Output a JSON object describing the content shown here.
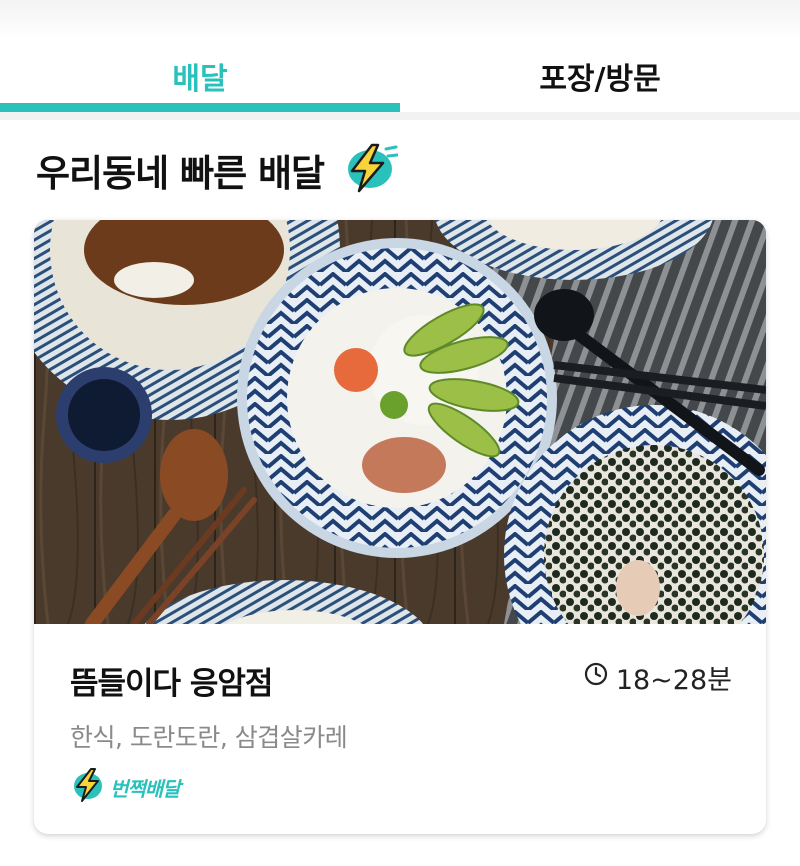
{
  "tabs": [
    {
      "label": "배달",
      "active": true
    },
    {
      "label": "포장/방문",
      "active": false
    }
  ],
  "section": {
    "title": "우리동네 빠른 배달",
    "icon": "lightning-bolt-icon"
  },
  "store": {
    "name": "뜸들이다 응암점",
    "delivery_time": "18~28분",
    "categories": "한식, 도란도란, 삼겹살카레",
    "badge": "번쩍배달",
    "photo": "food-photo"
  },
  "colors": {
    "accent": "#2ac1bc",
    "badge_yellow": "#f6d43a",
    "text_secondary": "#8a8a8a"
  }
}
